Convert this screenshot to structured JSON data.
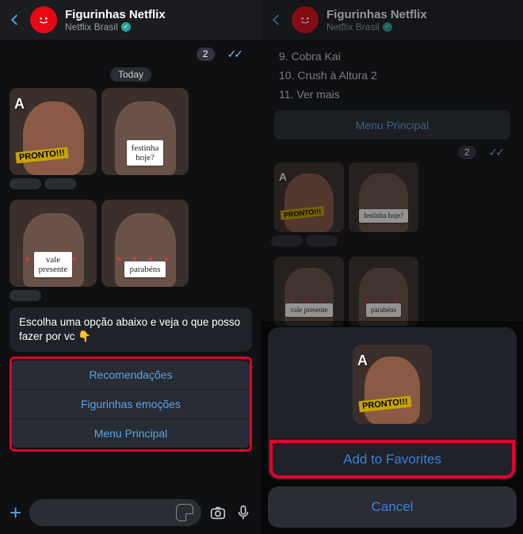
{
  "header": {
    "title": "Figurinhas Netflix",
    "subtitle": "Netflix Brasil"
  },
  "left": {
    "badge_count": "2",
    "date_label": "Today",
    "stickers": {
      "s1_a": "A",
      "s1_pronto": "PRONTO!!!",
      "s2_sign": "festinha\nhoje?",
      "s3_sign": "vale\npresente",
      "s4_sign": "parabéns"
    },
    "bot_message": "Escolha uma opção abaixo e veja o que posso fazer por vc 👇",
    "buttons": {
      "b1": "Recomendações",
      "b2": "Figurinhas emoções",
      "b3": "Menu Principal"
    }
  },
  "right": {
    "list": {
      "i9": "9. Cobra Kai",
      "i10": "10. Crush à Altura 2",
      "i11": "11. Ver mais"
    },
    "menu_button": "Menu Principal",
    "badge_count": "2",
    "sheet": {
      "preview_a": "A",
      "preview_pronto": "PRONTO!!!",
      "add": "Add to Favorites",
      "cancel": "Cancel"
    }
  }
}
